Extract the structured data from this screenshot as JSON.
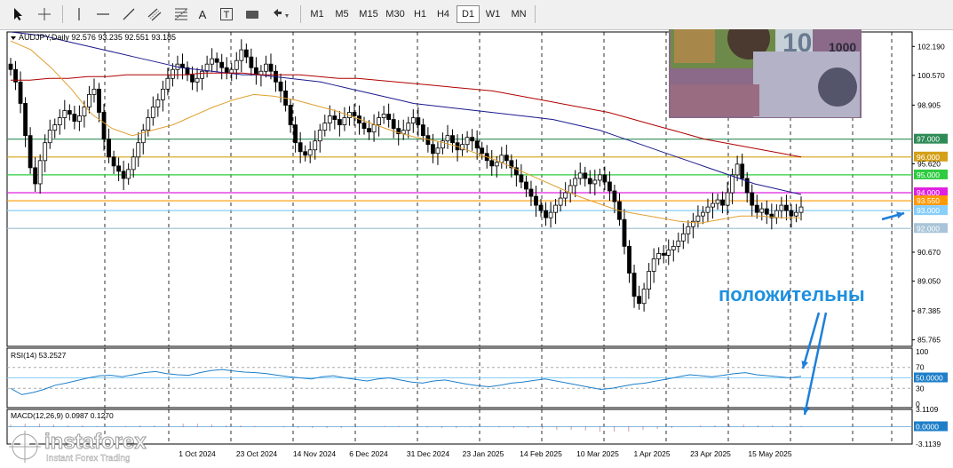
{
  "toolbar": {
    "tools": [
      "cursor-icon",
      "crosshair-icon",
      "vertical-line-icon",
      "horizontal-line-icon",
      "trendline-icon",
      "channel-icon",
      "fibonacci-icon",
      "text-icon",
      "text-label-icon",
      "shapes-icon",
      "arrows-icon"
    ],
    "text_tool_label": "A",
    "text_label_tool_label": "T",
    "timeframes": [
      "M1",
      "M5",
      "M15",
      "M30",
      "H1",
      "H4",
      "D1",
      "W1",
      "MN"
    ],
    "active_timeframe": "D1"
  },
  "chart_data": {
    "type": "candlestick",
    "symbol_header": "AUDJPY,Daily  92.576 93.235 92.551 93.185",
    "annotation": "положительны",
    "price_axis_ticks": [
      "102.190",
      "100.570",
      "98.905",
      "97.000",
      "96.000",
      "95.620",
      "95.000",
      "94.000",
      "93.550",
      "93.000",
      "92.000",
      "90.670",
      "89.050",
      "87.385",
      "85.765"
    ],
    "x_tick_labels": [
      "1 Oct 2024",
      "23 Oct 2024",
      "14 Nov 2024",
      "6 Dec 2024",
      "31 Dec 2024",
      "23 Jan 2025",
      "14 Feb 2025",
      "10 Mar 2025",
      "1 Apr 2025",
      "23 Apr 2025",
      "15 May 2025"
    ],
    "ylim": [
      85.4,
      103.0
    ],
    "horizontal_levels": [
      {
        "price": 97.0,
        "label": "97.000",
        "color": "#2e8b57"
      },
      {
        "price": 96.0,
        "label": "96.000",
        "color": "#d4a017"
      },
      {
        "price": 95.0,
        "label": "95.000",
        "color": "#2ecc40"
      },
      {
        "price": 94.0,
        "label": "94.000",
        "color": "#e020e0"
      },
      {
        "price": 93.55,
        "label": "93.550",
        "color": "#ff9900"
      },
      {
        "price": 93.0,
        "label": "93.000",
        "color": "#87cefa"
      },
      {
        "price": 92.0,
        "label": "92.000",
        "color": "#a9c4d8"
      }
    ],
    "price_series": [
      100.9,
      100.2,
      99.0,
      97.2,
      95.4,
      94.5,
      95.8,
      96.8,
      97.5,
      97.8,
      98.2,
      98.6,
      98.4,
      98.0,
      98.3,
      98.8,
      99.5,
      99.8,
      98.5,
      97.0,
      96.0,
      95.5,
      95.2,
      94.8,
      95.3,
      96.0,
      96.8,
      97.5,
      98.2,
      98.8,
      99.2,
      99.8,
      100.4,
      100.9,
      101.2,
      101.0,
      100.6,
      100.2,
      100.4,
      100.8,
      101.2,
      101.5,
      101.3,
      101.0,
      100.7,
      100.9,
      101.4,
      102.0,
      101.6,
      101.0,
      100.6,
      100.8,
      101.2,
      100.8,
      100.2,
      99.7,
      98.9,
      97.8,
      96.8,
      96.3,
      96.1,
      96.4,
      96.9,
      97.5,
      97.9,
      98.3,
      98.1,
      97.8,
      98.2,
      98.5,
      98.3,
      97.9,
      97.6,
      97.4,
      97.8,
      98.2,
      98.4,
      98.1,
      97.6,
      97.3,
      97.5,
      97.9,
      98.2,
      97.8,
      97.2,
      96.7,
      96.2,
      96.5,
      96.9,
      97.2,
      96.8,
      96.4,
      96.7,
      97.1,
      96.9,
      96.5,
      96.2,
      95.8,
      95.5,
      95.7,
      96.1,
      95.8,
      95.4,
      95.0,
      94.6,
      94.2,
      93.8,
      93.3,
      93.0,
      92.6,
      92.9,
      93.3,
      93.7,
      94.0,
      94.4,
      94.8,
      95.1,
      94.8,
      94.5,
      94.7,
      95.0,
      94.6,
      94.1,
      93.5,
      92.5,
      91.0,
      89.5,
      88.2,
      87.8,
      88.6,
      89.6,
      90.3,
      90.6,
      90.5,
      90.8,
      91.0,
      91.3,
      91.7,
      92.1,
      92.4,
      92.7,
      92.9,
      93.2,
      93.4,
      93.6,
      93.3,
      94.0,
      95.0,
      95.6,
      94.8,
      94.0,
      93.3,
      92.9,
      93.1,
      92.8,
      92.6,
      93.0,
      93.3,
      93.0,
      92.7,
      92.9,
      93.2
    ],
    "ma_blue": [
      103.0,
      102.9,
      102.8,
      102.6,
      102.4,
      102.2,
      102.0,
      101.8,
      101.6,
      101.4,
      101.2,
      101.0,
      100.9,
      100.8,
      100.7,
      100.6,
      100.6,
      100.5,
      100.4,
      100.3,
      100.2,
      100.0,
      99.8,
      99.6,
      99.4,
      99.2,
      99.0,
      98.9,
      98.8,
      98.7,
      98.6,
      98.5,
      98.4,
      98.3,
      98.2,
      98.1,
      97.9,
      97.7,
      97.5,
      97.2,
      96.9,
      96.6,
      96.3,
      96.0,
      95.7,
      95.4,
      95.1,
      94.8,
      94.5,
      94.3,
      94.1,
      93.9
    ],
    "ma_red": [
      100.3,
      100.3,
      100.4,
      100.4,
      100.5,
      100.5,
      100.6,
      100.6,
      100.6,
      100.6,
      100.7,
      100.7,
      100.7,
      100.6,
      100.6,
      100.6,
      100.5,
      100.4,
      100.4,
      100.3,
      100.2,
      100.1,
      100.0,
      99.9,
      99.8,
      99.7,
      99.5,
      99.3,
      99.1,
      98.9,
      98.7,
      98.5,
      98.2,
      97.9,
      97.6,
      97.3,
      97.0,
      96.8,
      96.6,
      96.4,
      96.2,
      96.0
    ],
    "ma_orange": [
      102.5,
      102.0,
      101.0,
      99.8,
      98.4,
      97.6,
      97.2,
      97.5,
      97.8,
      98.3,
      98.8,
      99.2,
      99.5,
      99.4,
      99.2,
      98.9,
      98.6,
      98.2,
      97.8,
      97.4,
      97.1,
      96.9,
      96.6,
      96.2,
      95.8,
      95.3,
      94.8,
      94.3,
      93.8,
      93.4,
      93.0,
      92.8,
      92.6,
      92.4,
      92.3,
      92.5,
      92.7,
      92.7,
      92.6,
      92.6
    ],
    "rsi": {
      "label": "RSI(14) 53.2527",
      "ticks": [
        "100",
        "70",
        "50",
        "30",
        "0"
      ],
      "current_label": "50.0000",
      "ylim": [
        0,
        100
      ],
      "values": [
        30,
        18,
        22,
        28,
        36,
        40,
        45,
        50,
        54,
        55,
        52,
        56,
        60,
        62,
        58,
        56,
        55,
        60,
        64,
        66,
        63,
        61,
        60,
        58,
        55,
        52,
        50,
        48,
        52,
        54,
        50,
        47,
        44,
        48,
        50,
        46,
        42,
        40,
        44,
        46,
        42,
        38,
        35,
        33,
        36,
        40,
        42,
        45,
        48,
        44,
        40,
        36,
        32,
        28,
        30,
        34,
        38,
        40,
        44,
        48,
        52,
        56,
        54,
        52,
        55,
        58,
        60,
        56,
        54,
        52,
        50,
        53
      ]
    },
    "macd": {
      "label": "MACD(12,26,9) 0.0987 0.1270",
      "ticks": [
        "3.1109",
        "0.0000",
        "-3.1139"
      ],
      "current_label": "0.0000",
      "ylim": [
        -3.1139,
        3.1109
      ],
      "histogram": [
        0.4,
        0.6,
        0.5,
        0.4,
        0.3,
        0.2,
        0.1,
        0.0,
        0.1,
        0.2,
        0.3,
        0.4,
        0.5,
        0.5,
        0.4,
        0.3,
        0.2,
        0.1,
        0.0,
        -0.1,
        -0.2,
        -0.3,
        -0.3,
        -0.2,
        -0.1,
        0.0,
        0.1,
        0.1,
        0.0,
        -0.1,
        -0.2,
        -0.2,
        -0.1,
        0.0,
        -0.1,
        -0.2,
        -0.3,
        -0.4,
        -0.5,
        -0.6,
        -0.7,
        -0.8,
        -0.9,
        -0.8,
        -0.6,
        -0.4,
        -0.2,
        0.0,
        0.2,
        0.3,
        0.4,
        0.4,
        0.3,
        0.2,
        0.1,
        0.1
      ]
    }
  },
  "watermark": {
    "brand": "instaforex",
    "tagline": "Instant Forex Trading"
  },
  "colors": {
    "candle": "#000000",
    "ma_blue": "#1a1a8c",
    "ma_red": "#b00000",
    "ma_orange": "#e0a030",
    "indicator_line": "#1e7fc8",
    "annotation_text": "#1e90e0",
    "annotation_arrow": "#1e7fd8",
    "grid": "#000000"
  }
}
